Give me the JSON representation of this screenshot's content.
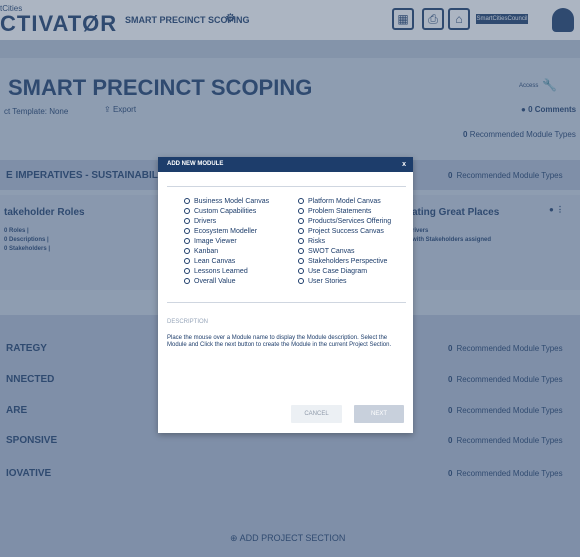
{
  "topbar": {
    "logo_small": "tCities",
    "logo_big": "CTIVATØR",
    "title": "SMART PRECINCT SCOPING",
    "brand": "SmartCitiesCouncil"
  },
  "project": {
    "title": "SMART PRECINCT SCOPING",
    "template_label": "ct Template: None",
    "export_label": "Export",
    "access_label": "Access",
    "comments": "0",
    "comments_label": "Comments",
    "recommended_count": "0",
    "recommended_label": "Recommended Module Types"
  },
  "section1": {
    "title": "E IMPERATIVES - SUSTAINABILI",
    "rec_count": "0",
    "rec_label": "Recommended Module Types"
  },
  "cards": {
    "left": {
      "title": "takeholder Roles",
      "lines": [
        "0 Roles   |",
        "0 Descriptions  |",
        "0 Stakeholders  |"
      ]
    },
    "right": {
      "title": "ating Great Places",
      "lines": [
        "rivers",
        "with Stakeholders assigned"
      ]
    }
  },
  "sections": [
    {
      "title": "RATEGY",
      "rec_count": "0",
      "rec_label": "Recommended Module Types"
    },
    {
      "title": "NNECTED",
      "rec_count": "0",
      "rec_label": "Recommended Module Types"
    },
    {
      "title": "ARE",
      "rec_count": "0",
      "rec_label": "Recommended Module Types"
    },
    {
      "title": "SPONSIVE",
      "rec_count": "0",
      "rec_label": "Recommended Module Types"
    },
    {
      "title": "IOVATIVE",
      "rec_count": "0",
      "rec_label": "Recommended Module Types"
    }
  ],
  "add_section_label": "ADD PROJECT SECTION",
  "modal": {
    "title": "ADD NEW MODULE",
    "close": "x",
    "options_left": [
      "Business Model Canvas",
      "Custom Capabilities",
      "Drivers",
      "Ecosystem Modeller",
      "Image Viewer",
      "Kanban",
      "Lean Canvas",
      "Lessons Learned",
      "Overall Value"
    ],
    "options_right": [
      "Platform Model Canvas",
      "Problem Statements",
      "Products/Services Offering",
      "Project Success Canvas",
      "Risks",
      "SWOT Canvas",
      "Stakeholders Perspective",
      "Use Case Diagram",
      "User Stories"
    ],
    "description_label": "DESCRIPTION",
    "description_text": "Place the mouse over a Module name to display the Module description. Select the Module and Click the next button to create the Module in the current Project Section.",
    "cancel": "CANCEL",
    "next": "NEXT"
  }
}
